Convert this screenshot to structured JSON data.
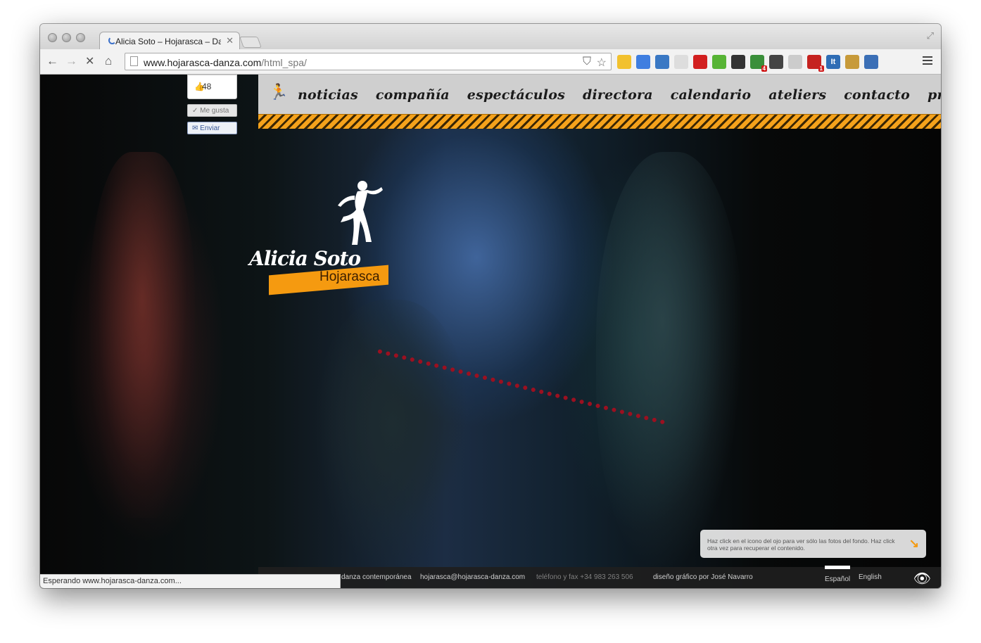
{
  "browser": {
    "tab_title": "Alicia Soto – Hojarasca – Dan",
    "url_host": "www.hojarasca-danza.com",
    "url_path": "/html_spa/",
    "status_text": "Esperando www.hojarasca-danza.com..."
  },
  "extensions": [
    {
      "name": "keep-icon",
      "color": "#f2c12e"
    },
    {
      "name": "translate-icon",
      "color": "#3f7ee0"
    },
    {
      "name": "screen-capture-icon",
      "color": "#3a78c4"
    },
    {
      "name": "gmail-checker-icon",
      "color": "#dddddd"
    },
    {
      "name": "stop-icon",
      "color": "#d21f1f"
    },
    {
      "name": "spotify-icon",
      "color": "#57b435"
    },
    {
      "name": "send-to-phone-icon",
      "color": "#333333"
    },
    {
      "name": "notifications-icon",
      "color": "#3a8f3a",
      "badge": "4"
    },
    {
      "name": "evernote-icon",
      "color": "#444444"
    },
    {
      "name": "mail-icon",
      "color": "#cccccc"
    },
    {
      "name": "gmail-icon",
      "color": "#c5221f",
      "badge": "1"
    },
    {
      "name": "instapaper-icon",
      "color": "#2f6db5",
      "label": "It"
    },
    {
      "name": "package-icon",
      "color": "#c79a3a"
    },
    {
      "name": "window-resize-icon",
      "color": "#3b6fb6"
    }
  ],
  "facebook": {
    "count": "48",
    "like_label": "Me gusta",
    "send_label": "Enviar"
  },
  "nav": {
    "items": [
      "noticias",
      "compañía",
      "espectáculos",
      "directora",
      "calendario",
      "ateliers",
      "contacto",
      "prensa"
    ]
  },
  "logo": {
    "name": "Alicia Soto",
    "company": "Hojarasca"
  },
  "info": {
    "text": "Haz click en el icono del ojo para ver sólo las fotos del fondo. Haz click otra vez para recuperar el contenido."
  },
  "footer": {
    "tagline": "danza contemporánea",
    "email": "hojarasca@hojarasca-danza.com",
    "phone": "teléfono y fax +34 983 263 506",
    "credit": "diseño gráfico por José Navarro",
    "lang_es": "Español",
    "lang_en": "English"
  },
  "colors": {
    "accent": "#f59a10",
    "nav_bg": "#cfcfcf",
    "footer_bg": "#1e1e1e"
  }
}
